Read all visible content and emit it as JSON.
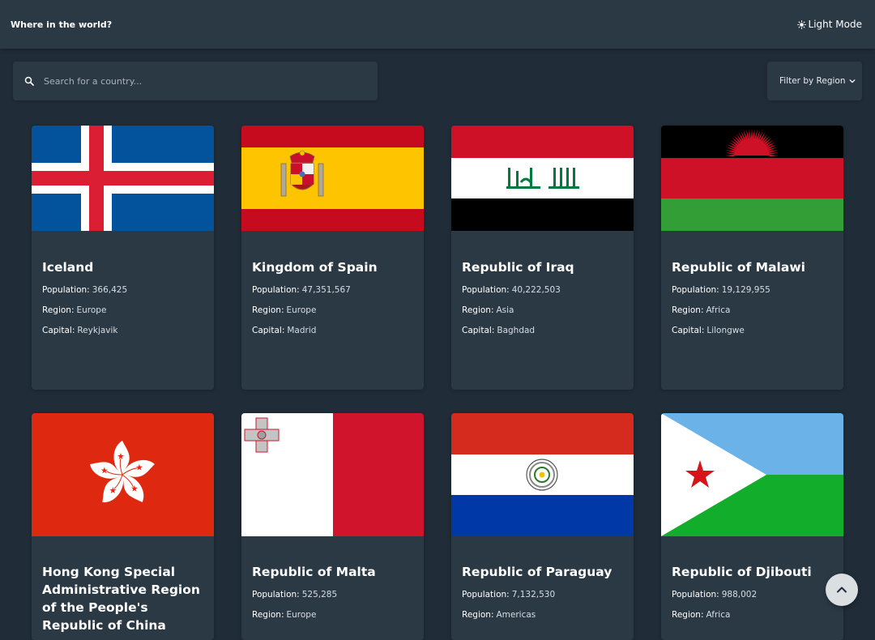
{
  "header": {
    "title": "Where in the world?",
    "mode_label": "Light Mode",
    "mode_icon": "sun-icon"
  },
  "search": {
    "placeholder": "Search for a country...",
    "icon": "search-icon"
  },
  "filter": {
    "label": "Filter by Region",
    "icon": "chevron-down-icon"
  },
  "labels": {
    "population": "Population:",
    "region": "Region:",
    "capital": "Capital:"
  },
  "countries": [
    {
      "name": "Iceland",
      "population": "366,425",
      "region": "Europe",
      "capital": "Reykjavik"
    },
    {
      "name": "Kingdom of Spain",
      "population": "47,351,567",
      "region": "Europe",
      "capital": "Madrid"
    },
    {
      "name": "Republic of Iraq",
      "population": "40,222,503",
      "region": "Asia",
      "capital": "Baghdad"
    },
    {
      "name": "Republic of Malawi",
      "population": "19,129,955",
      "region": "Africa",
      "capital": "Lilongwe"
    },
    {
      "name": "Hong Kong Special Administrative Region of the People's Republic of China",
      "population": "",
      "region": "",
      "capital": ""
    },
    {
      "name": "Republic of Malta",
      "population": "525,285",
      "region": "Europe",
      "capital": ""
    },
    {
      "name": "Republic of Paraguay",
      "population": "7,132,530",
      "region": "Americas",
      "capital": ""
    },
    {
      "name": "Republic of Djibouti",
      "population": "988,002",
      "region": "Africa",
      "capital": ""
    }
  ],
  "scroll_top_icon": "chevron-up-icon",
  "colors": {
    "background": "#202c37",
    "elements": "#2b3945",
    "text": "#ffffff"
  }
}
